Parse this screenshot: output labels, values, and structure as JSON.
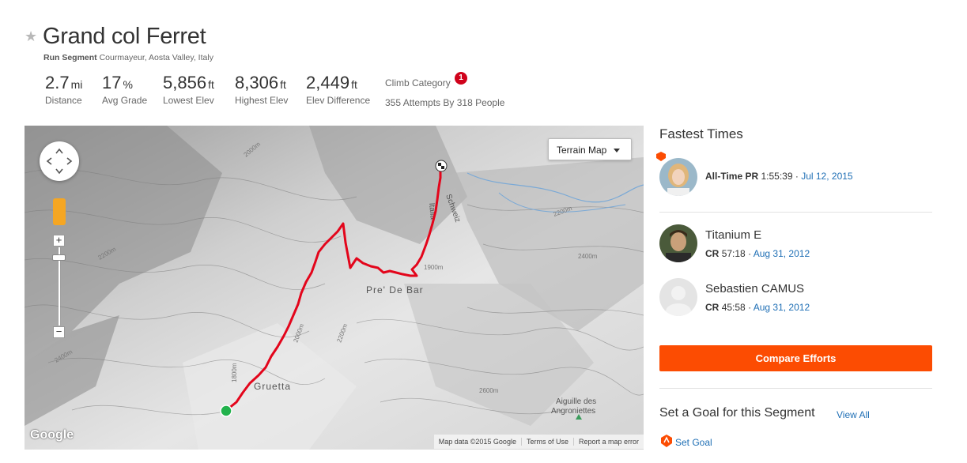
{
  "segment": {
    "title": "Grand col Ferret",
    "type_label": "Run Segment",
    "location": "Courmayeur, Aosta Valley, Italy"
  },
  "stats": [
    {
      "value": "2.7",
      "unit": "mi",
      "label": "Distance"
    },
    {
      "value": "17",
      "unit": "%",
      "label": "Avg Grade"
    },
    {
      "value": "5,856",
      "unit": "ft",
      "label": "Lowest Elev"
    },
    {
      "value": "8,306",
      "unit": "ft",
      "label": "Highest Elev"
    },
    {
      "value": "2,449",
      "unit": "ft",
      "label": "Elev Difference"
    }
  ],
  "climb": {
    "label": "Climb Category",
    "category": "1",
    "attempts": "355 Attempts By 318 People"
  },
  "map": {
    "type_button": "Terrain Map",
    "logo": "Google",
    "attribution": [
      "Map data ©2015 Google",
      "Terms of Use",
      "Report a map error"
    ],
    "zoom_in": "+",
    "zoom_out": "−",
    "place_labels": [
      "Pre' De Bar",
      "Gruetta",
      "Aiguille des Angroniettes",
      "Schweiz",
      "Italia"
    ],
    "contour_labels": [
      "2000m",
      "2200m",
      "2400m",
      "2600m",
      "1800m",
      "1900m"
    ],
    "route_color": "#e3051b",
    "start_color": "#22b24c"
  },
  "fastest": {
    "heading": "Fastest Times",
    "entries": [
      {
        "name": "",
        "prefix": "All-Time PR",
        "time": "1:55:39",
        "sep": "·",
        "date": "Jul 12, 2015"
      },
      {
        "name": "Titanium E",
        "prefix": "CR",
        "time": "57:18",
        "sep": "·",
        "date": "Aug 31, 2012"
      },
      {
        "name": "Sebastien CAMUS",
        "prefix": "CR",
        "time": "45:58",
        "sep": "·",
        "date": "Aug 31, 2012"
      }
    ]
  },
  "compare_button": "Compare Efforts",
  "goal": {
    "heading": "Set a Goal for this Segment",
    "view_all": "View All",
    "set_goal": "Set Goal"
  },
  "colors": {
    "accent": "#fc4c02",
    "link": "#1f6fb5",
    "badge": "#d0021b"
  }
}
